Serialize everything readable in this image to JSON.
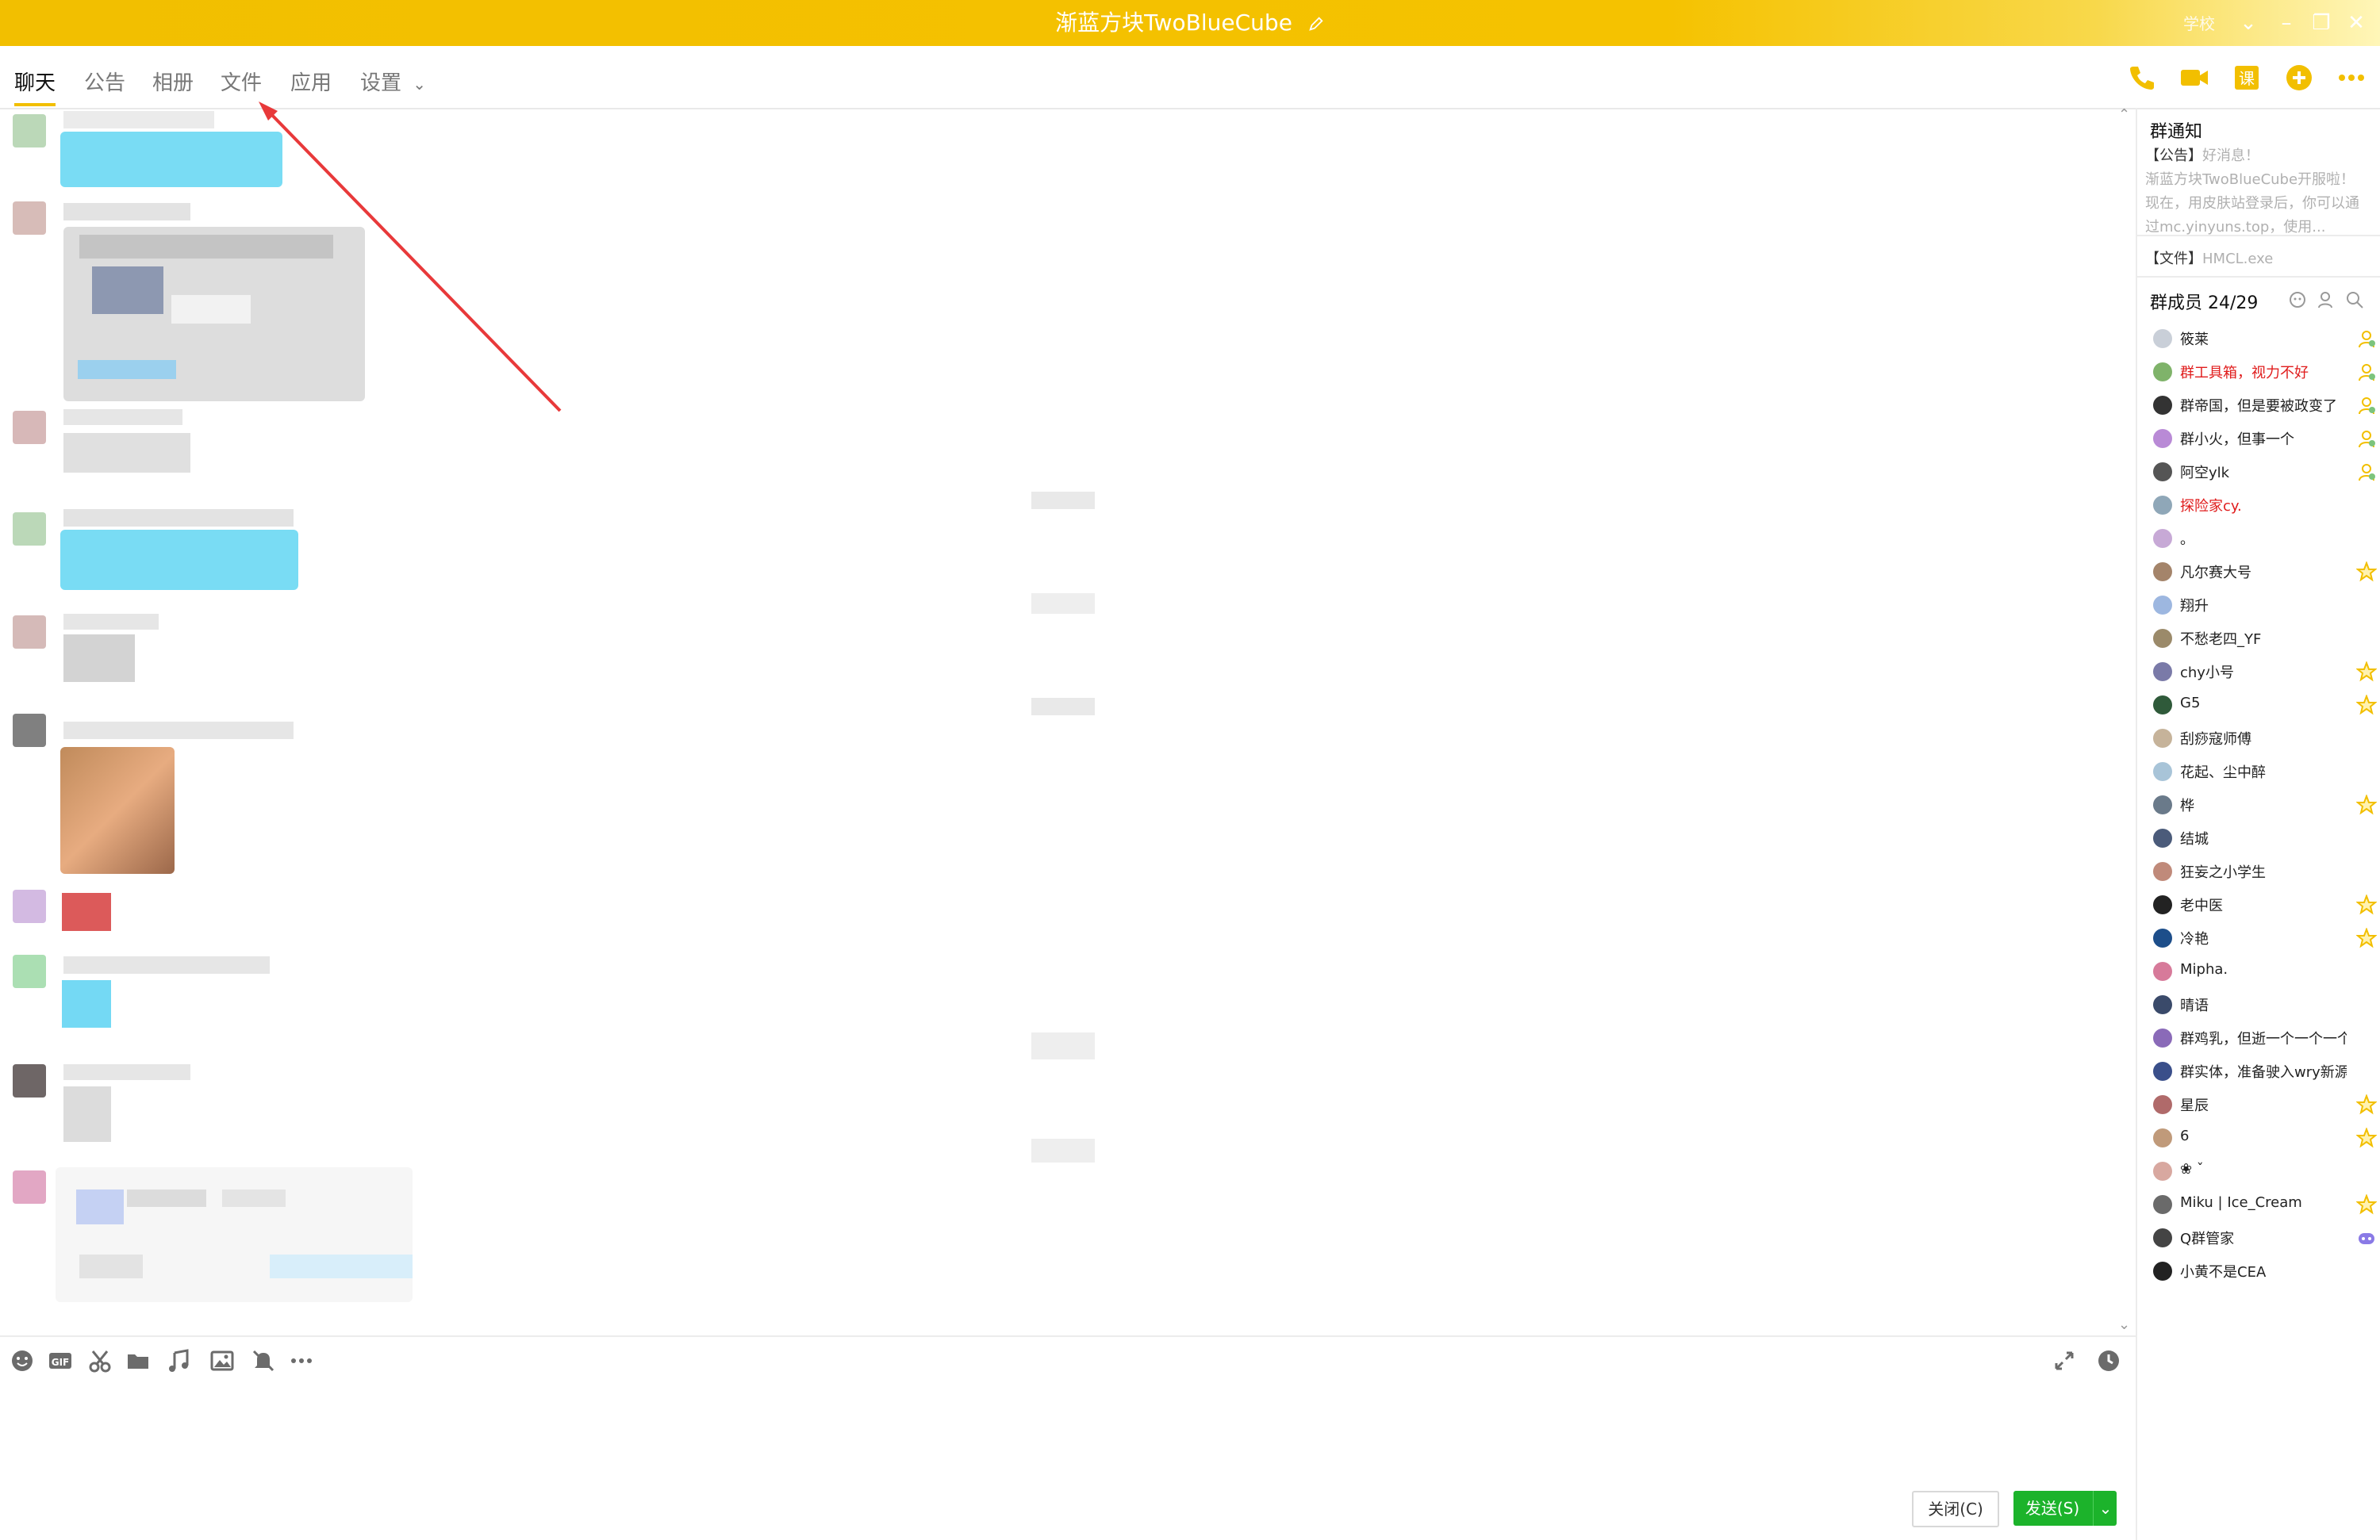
{
  "window": {
    "title": "渐蓝方块TwoBlueCube",
    "user_label": "学校"
  },
  "nav": {
    "tabs": [
      "聊天",
      "公告",
      "相册",
      "文件",
      "应用",
      "设置"
    ],
    "settings_chevron": "⌄"
  },
  "side": {
    "notice_title": "群通知",
    "notice_lines": [
      {
        "tag": "【公告】",
        "text": "好消息！"
      },
      {
        "tag": "",
        "text": "渐蓝方块TwoBlueCube开服啦！"
      },
      {
        "tag": "",
        "text": "现在，用皮肤站登录后，你可以通"
      },
      {
        "tag": "",
        "text": "过mc.yinyuns.top，使用..."
      }
    ],
    "file_line": {
      "tag": "【文件】",
      "text": "HMCL.exe"
    },
    "members_title": "群成员 24/29",
    "members": [
      {
        "name": "筱莱",
        "red": false,
        "badge": "admin-icon",
        "color": "#c9cfd8"
      },
      {
        "name": "群工具箱，视力不好",
        "red": true,
        "badge": "admin-icon",
        "color": "#7fb36a"
      },
      {
        "name": "群帝国，但是要被政变了",
        "red": false,
        "badge": "admin-icon",
        "color": "#333333"
      },
      {
        "name": "群小火，但事一个",
        "red": false,
        "badge": "admin-icon",
        "color": "#b98ad6"
      },
      {
        "name": "阿空ylk",
        "red": false,
        "badge": "admin-icon",
        "color": "#555555"
      },
      {
        "name": "探险家cy.",
        "red": true,
        "badge": "",
        "color": "#8fa7b8"
      },
      {
        "name": "。",
        "red": false,
        "badge": "",
        "color": "#c7a9d6"
      },
      {
        "name": "凡尔赛大号",
        "red": false,
        "badge": "star-icon",
        "color": "#a4846a"
      },
      {
        "name": "翔升",
        "red": false,
        "badge": "",
        "color": "#9db7e0"
      },
      {
        "name": "不愁老四_YF",
        "red": false,
        "badge": "",
        "color": "#9b8a6a"
      },
      {
        "name": "chy小号",
        "red": false,
        "badge": "star-icon",
        "color": "#7a7aa8"
      },
      {
        "name": "G5",
        "red": false,
        "badge": "star-icon",
        "color": "#2f5a3a"
      },
      {
        "name": "刮痧寇师傅",
        "red": false,
        "badge": "",
        "color": "#c6b39a"
      },
      {
        "name": "花起、尘中醉",
        "red": false,
        "badge": "",
        "color": "#a8c4d8"
      },
      {
        "name": "桦",
        "red": false,
        "badge": "star-icon",
        "color": "#6a7a8a"
      },
      {
        "name": "结城",
        "red": false,
        "badge": "",
        "color": "#4b5b7a"
      },
      {
        "name": "狂妄之小学生",
        "red": false,
        "badge": "",
        "color": "#c08a7a"
      },
      {
        "name": "老中医",
        "red": false,
        "badge": "star-icon",
        "color": "#222222"
      },
      {
        "name": "冷艳",
        "red": false,
        "badge": "star-icon",
        "color": "#1d4e8a"
      },
      {
        "name": "Mipha.",
        "red": false,
        "badge": "",
        "color": "#d77a9a"
      },
      {
        "name": "晴语",
        "red": false,
        "badge": "",
        "color": "#3a4a6a"
      },
      {
        "name": "群鸡乳，但逝一个一个一个小",
        "red": false,
        "badge": "",
        "color": "#8a6ab8"
      },
      {
        "name": "群实体，准备驶入wry新源",
        "red": false,
        "badge": "",
        "color": "#3a4f8a"
      },
      {
        "name": "星辰",
        "red": false,
        "badge": "star-icon",
        "color": "#b06a6a"
      },
      {
        "name": "6",
        "red": false,
        "badge": "star-icon",
        "color": "#c09a7a"
      },
      {
        "name": "❀ ˇ",
        "red": false,
        "badge": "",
        "color": "#d8a8a0"
      },
      {
        "name": "Miku | Ice_Cream",
        "red": false,
        "badge": "star-icon",
        "color": "#6a6a6a"
      },
      {
        "name": "Q群管家",
        "red": false,
        "badge": "bot-icon",
        "color": "#444444"
      },
      {
        "name": "小黄不是CEA",
        "red": false,
        "badge": "",
        "color": "#222222"
      }
    ]
  },
  "input": {
    "close_label": "关闭(C)",
    "send_label": "发送(S)",
    "send_dropdown": "⌄"
  },
  "colors": {
    "titlebar": "#f2bf00",
    "accent": "#f2bf00",
    "send": "#1cb32b",
    "arrow": "#e8393a"
  }
}
